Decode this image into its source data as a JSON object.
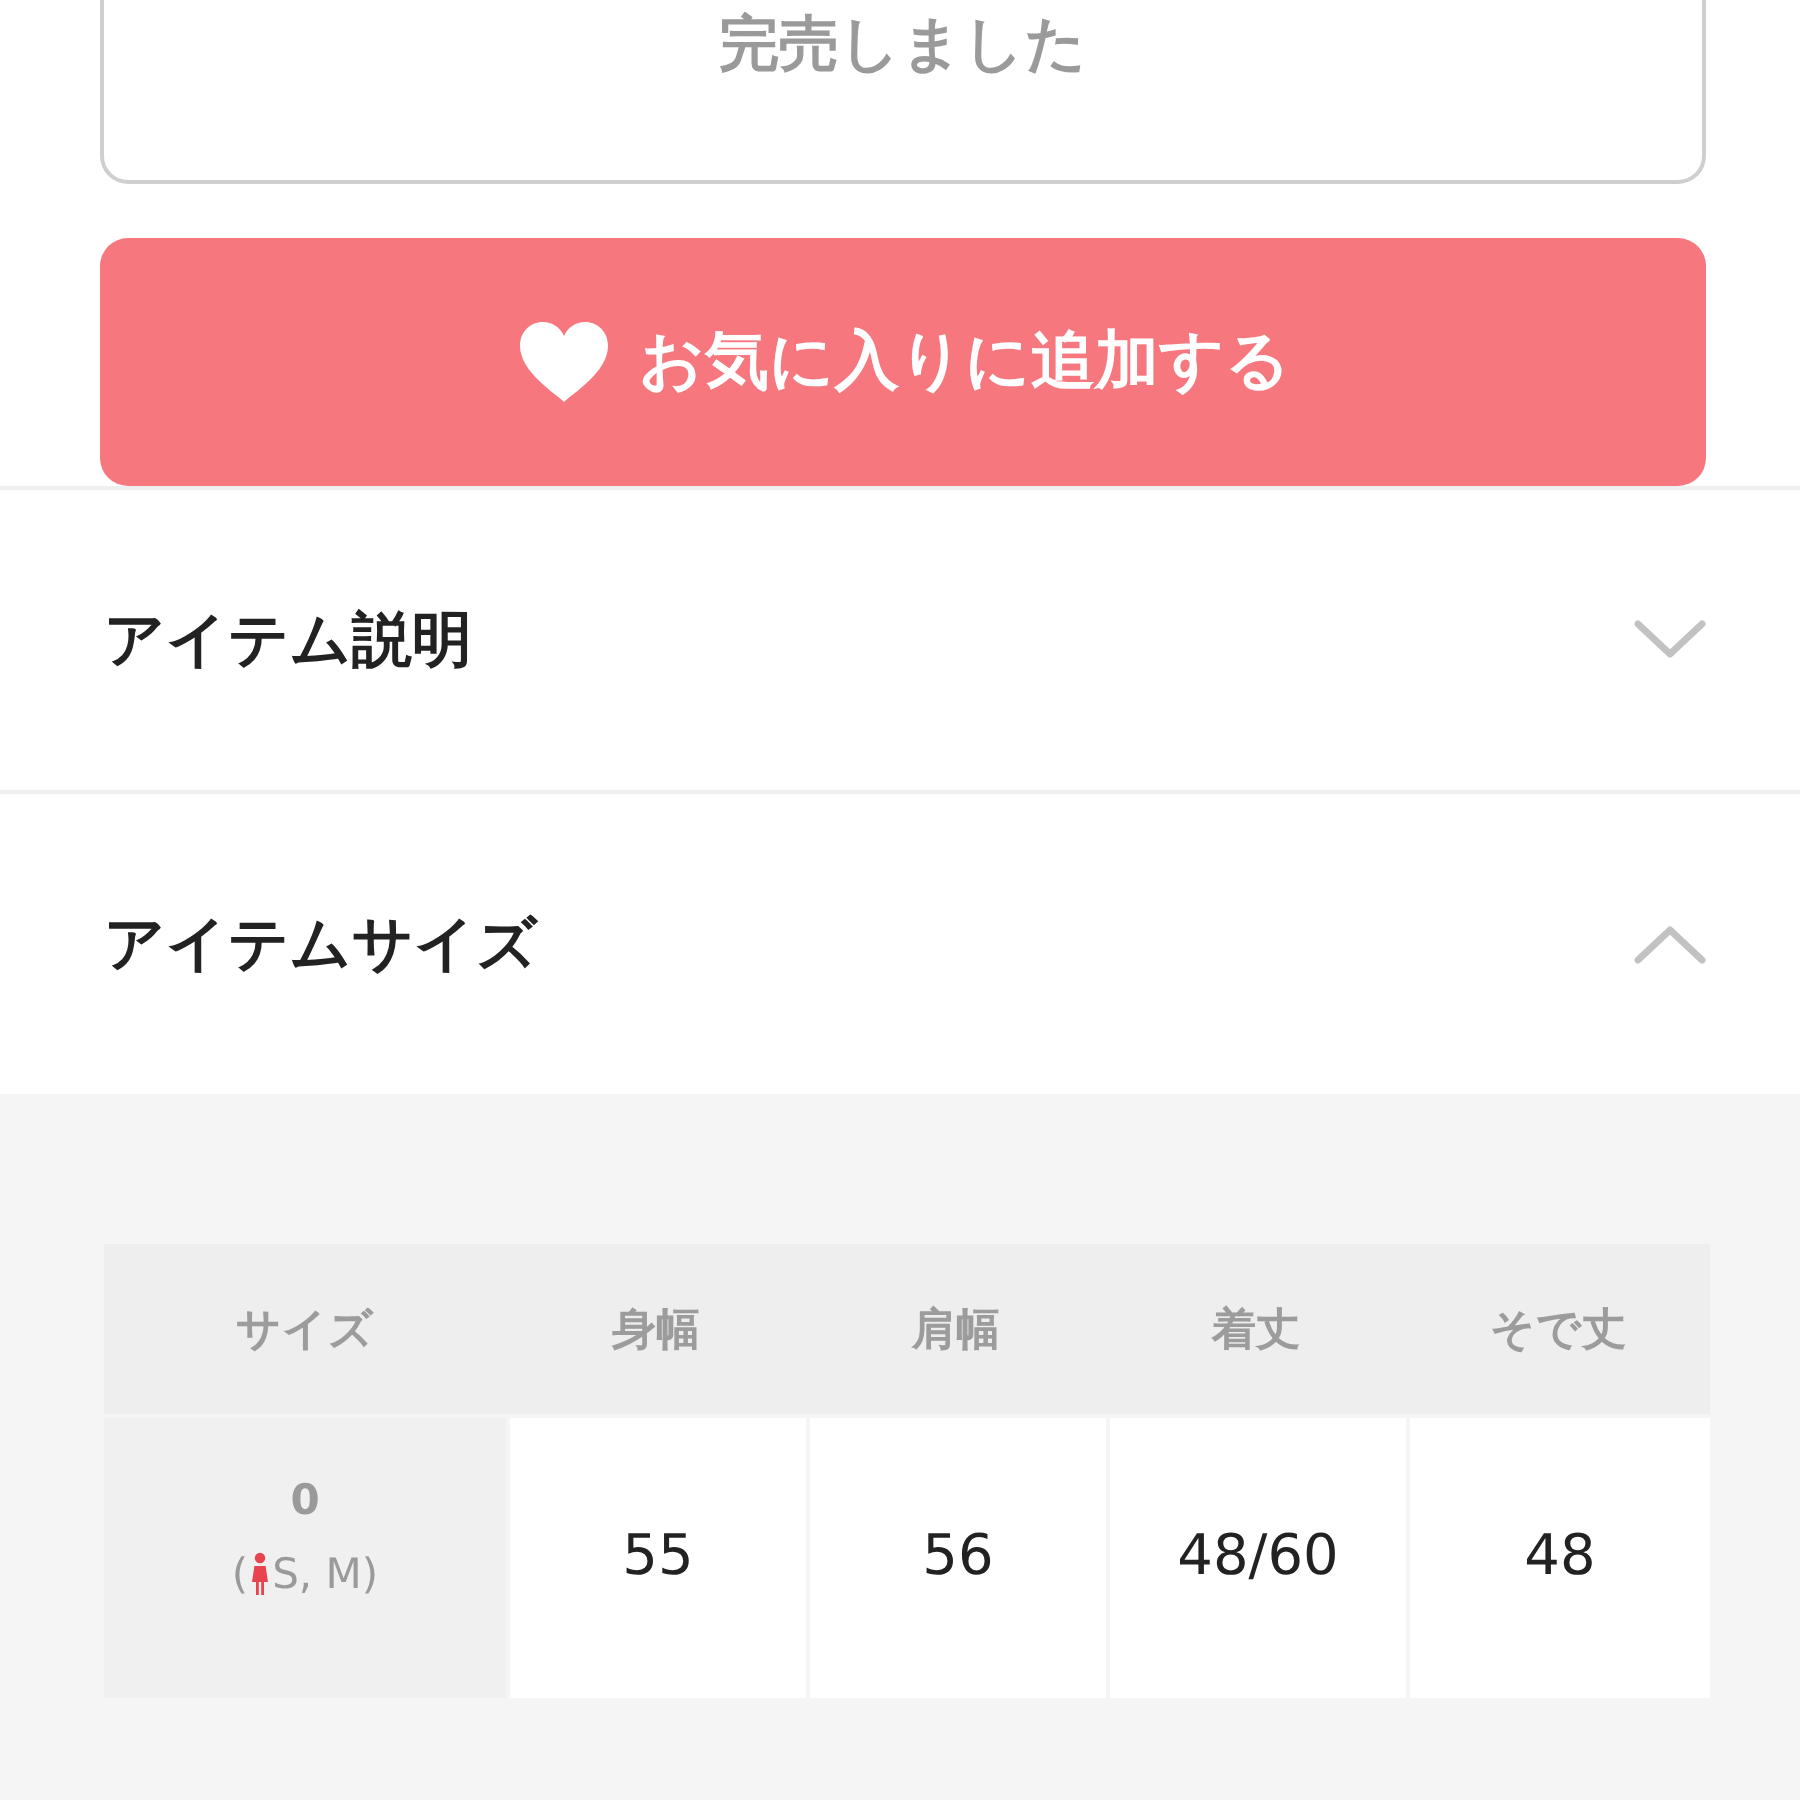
{
  "sold_out_button": {
    "label": "完売しました",
    "disabled": true
  },
  "favorite_button": {
    "label": "お気に入りに追加する"
  },
  "sections": [
    {
      "title": "アイテム説明",
      "expanded": false
    },
    {
      "title": "アイテムサイズ",
      "expanded": true
    }
  ],
  "size_table": {
    "columns": [
      "サイズ",
      "身幅",
      "肩幅",
      "着丈",
      "そで丈"
    ],
    "rows": [
      {
        "size": "0",
        "fit_open": "(",
        "fit_label": "S, M)",
        "values": [
          "55",
          "56",
          "48/60",
          "48"
        ]
      }
    ]
  }
}
